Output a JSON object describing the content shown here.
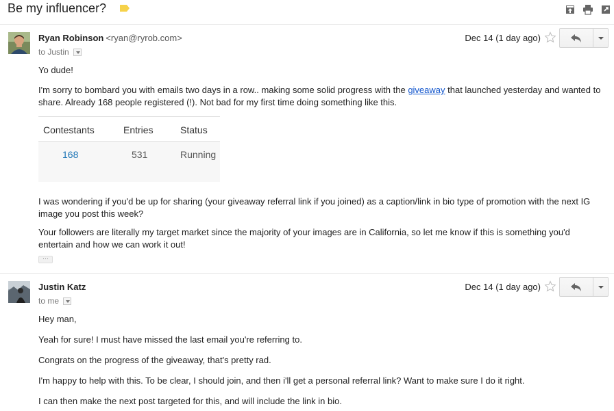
{
  "thread": {
    "subject": "Be my influencer?",
    "label_color": "#f6d24a"
  },
  "header_icons": [
    "archive-up-icon",
    "print-icon",
    "open-new-window-icon"
  ],
  "messages": [
    {
      "sender_name": "Ryan Robinson",
      "sender_email": "<ryan@ryrob.com>",
      "to": "to Justin",
      "date": "Dec 14 (1 day ago)",
      "body": {
        "greeting": "Yo dude!",
        "p1_before": "I'm sorry to bombard you with emails two days in a row.. making some solid progress with the ",
        "p1_link": "giveaway",
        "p1_after": " that launched yesterday and wanted to share. Already 168 people registered (!). Not bad for my first time doing something like this.",
        "table": {
          "headers": [
            "Contestants",
            "Entries",
            "Status"
          ],
          "row": [
            "168",
            "531",
            "Running"
          ]
        },
        "p2": "I was wondering if you'd be up for sharing (your giveaway referral link if you joined) as a caption/link in bio type of promotion with the next IG image you post this week?",
        "p3": "Your followers are literally my target market since the majority of your images are in California, so let me know if this is something you'd entertain and how we can work it out!",
        "ellipsis": "···"
      }
    },
    {
      "sender_name": "Justin Katz",
      "sender_email": "",
      "to": "to me",
      "date": "Dec 14 (1 day ago)",
      "body": {
        "l1": "Hey man,",
        "l2": "Yeah for sure! I must have missed the last email you're referring to.",
        "l3": "Congrats on the progress of the giveaway, that's pretty rad.",
        "l4": "I'm happy to help with this. To be clear, I should join, and then i'll get a personal referral link? Want to make sure I do it right.",
        "l5": "I can then make the next post targeted for this, and will include the link in bio."
      }
    }
  ]
}
